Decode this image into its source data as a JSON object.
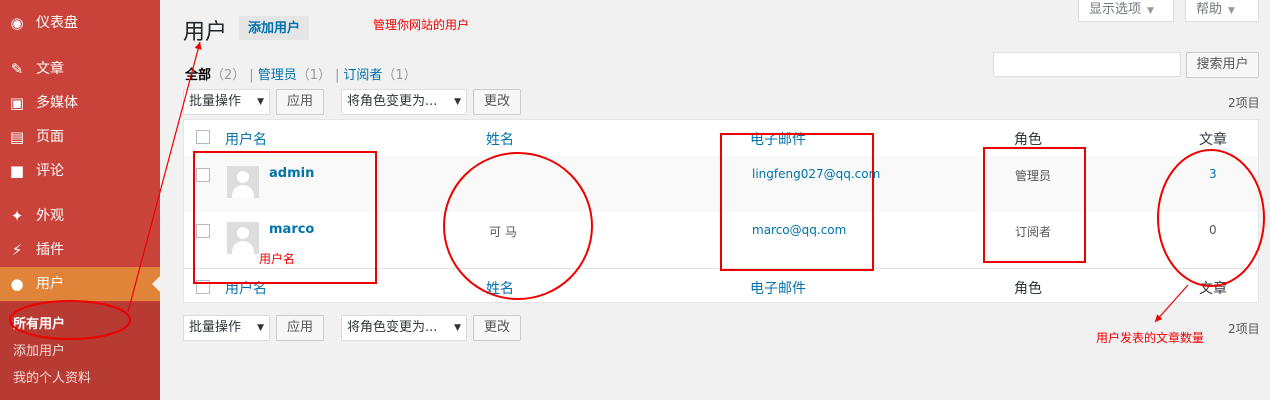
{
  "sidebar": {
    "items": [
      {
        "icon": "dashboard-icon",
        "glyph": "◉",
        "label": "仪表盘"
      },
      {
        "icon": "pin-icon",
        "glyph": "✎",
        "label": "文章"
      },
      {
        "icon": "media-icon",
        "glyph": "▣",
        "label": "多媒体"
      },
      {
        "icon": "page-icon",
        "glyph": "▤",
        "label": "页面"
      },
      {
        "icon": "comment-icon",
        "glyph": "■",
        "label": "评论"
      },
      {
        "icon": "appearance-icon",
        "glyph": "✦",
        "label": "外观"
      },
      {
        "icon": "plugin-icon",
        "glyph": "⚡",
        "label": "插件"
      },
      {
        "icon": "user-icon",
        "glyph": "●",
        "label": "用户"
      }
    ],
    "submenu": [
      "所有用户",
      "添加用户",
      "我的个人资料"
    ]
  },
  "header": {
    "title": "用户",
    "add_new": "添加用户",
    "screen_options": "显示选项",
    "help": "帮助"
  },
  "views": {
    "all": "全部",
    "all_count": "（2）",
    "admin": "管理员",
    "admin_count": "（1）",
    "subscriber": "订阅者",
    "subscriber_count": "（1）"
  },
  "search": {
    "button": "搜索用户",
    "value": ""
  },
  "bulk": {
    "select": "批量操作",
    "apply": "应用"
  },
  "role_change": {
    "select": "将角色变更为...",
    "button": "更改"
  },
  "items_count": "2项目",
  "table": {
    "columns": [
      "用户名",
      "姓名",
      "电子邮件",
      "角色",
      "文章"
    ],
    "rows": [
      {
        "username": "admin",
        "name": "",
        "email": "lingfeng027@qq.com",
        "role": "管理员",
        "posts": "3"
      },
      {
        "username": "marco",
        "name": "可 马",
        "email": "marco@qq.com",
        "role": "订阅者",
        "posts": "0"
      }
    ]
  },
  "annotations": {
    "manage_users": "管理你网站的用户",
    "username": "用户名",
    "post_count": "用户发表的文章数量"
  },
  "colors": {
    "sidebar": "#c9433b",
    "active": "#e0843a",
    "link": "#0073aa",
    "annotation": "#e00000"
  }
}
